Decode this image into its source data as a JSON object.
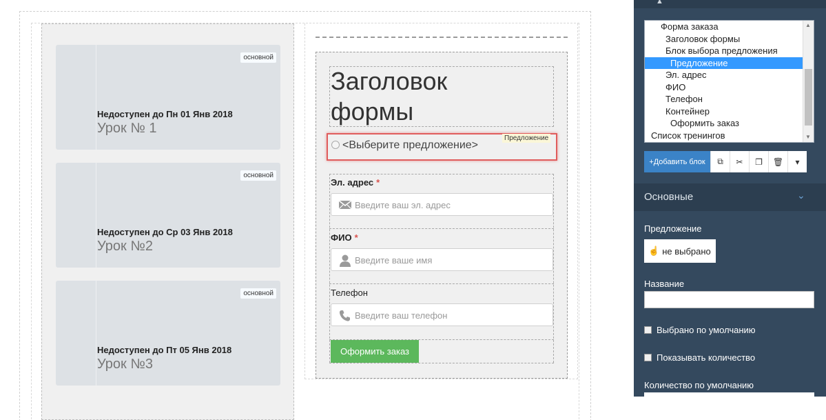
{
  "lessons": [
    {
      "badge": "основной",
      "status": "Недоступен до Пн 01 Янв 2018",
      "title": "Урок № 1"
    },
    {
      "badge": "основной",
      "status": "Недоступен до Ср 03 Янв 2018",
      "title": "Урок №2"
    },
    {
      "badge": "основной",
      "status": "Недоступен до Пт 05 Янв 2018",
      "title": "Урок №3"
    }
  ],
  "form": {
    "heading_line1": "Заголовок",
    "heading_line2": "формы",
    "offer_tag": "Предложение",
    "offer_text": "<Выберите предложение>",
    "email_label": "Эл. адрес",
    "email_placeholder": "Введите ваш эл. адрес",
    "name_label": "ФИО",
    "name_placeholder": "Введите ваше имя",
    "phone_label": "Телефон",
    "phone_placeholder": "Введите ваш телефон",
    "required_mark": "*",
    "order_button": "Оформить заказ"
  },
  "tree": {
    "items": [
      {
        "label": "Форма заказа",
        "selected": false
      },
      {
        "label": "Заголовок формы",
        "selected": false
      },
      {
        "label": "Блок выбора предложения",
        "selected": false
      },
      {
        "label": "Предложение",
        "selected": true
      },
      {
        "label": "Эл. адрес",
        "selected": false
      },
      {
        "label": "ФИО",
        "selected": false
      },
      {
        "label": "Телефон",
        "selected": false
      },
      {
        "label": "Контейнер",
        "selected": false
      },
      {
        "label": "Оформить заказ",
        "selected": false
      },
      {
        "label": "Список тренингов",
        "selected": false
      }
    ]
  },
  "toolbar": {
    "add_block": "+Добавить блок",
    "icons": [
      "copy-icon",
      "cut-icon",
      "paste-icon",
      "delete-icon",
      "dropdown-icon"
    ]
  },
  "panel": {
    "section_title": "Основные",
    "offer_label": "Предложение",
    "offer_value": "не выбрано",
    "name_label": "Название",
    "name_value": "",
    "default_selected": "Выбрано по умолчанию",
    "show_quantity": "Показывать количество",
    "default_quantity": "Количество по умолчанию"
  },
  "colors": {
    "panel_bg": "#34495e",
    "panel_dark": "#2c3e50",
    "selected": "#3399ff",
    "order_button": "#5cb85c",
    "add_button": "#3b83c7",
    "highlight": "#e05c5c"
  }
}
